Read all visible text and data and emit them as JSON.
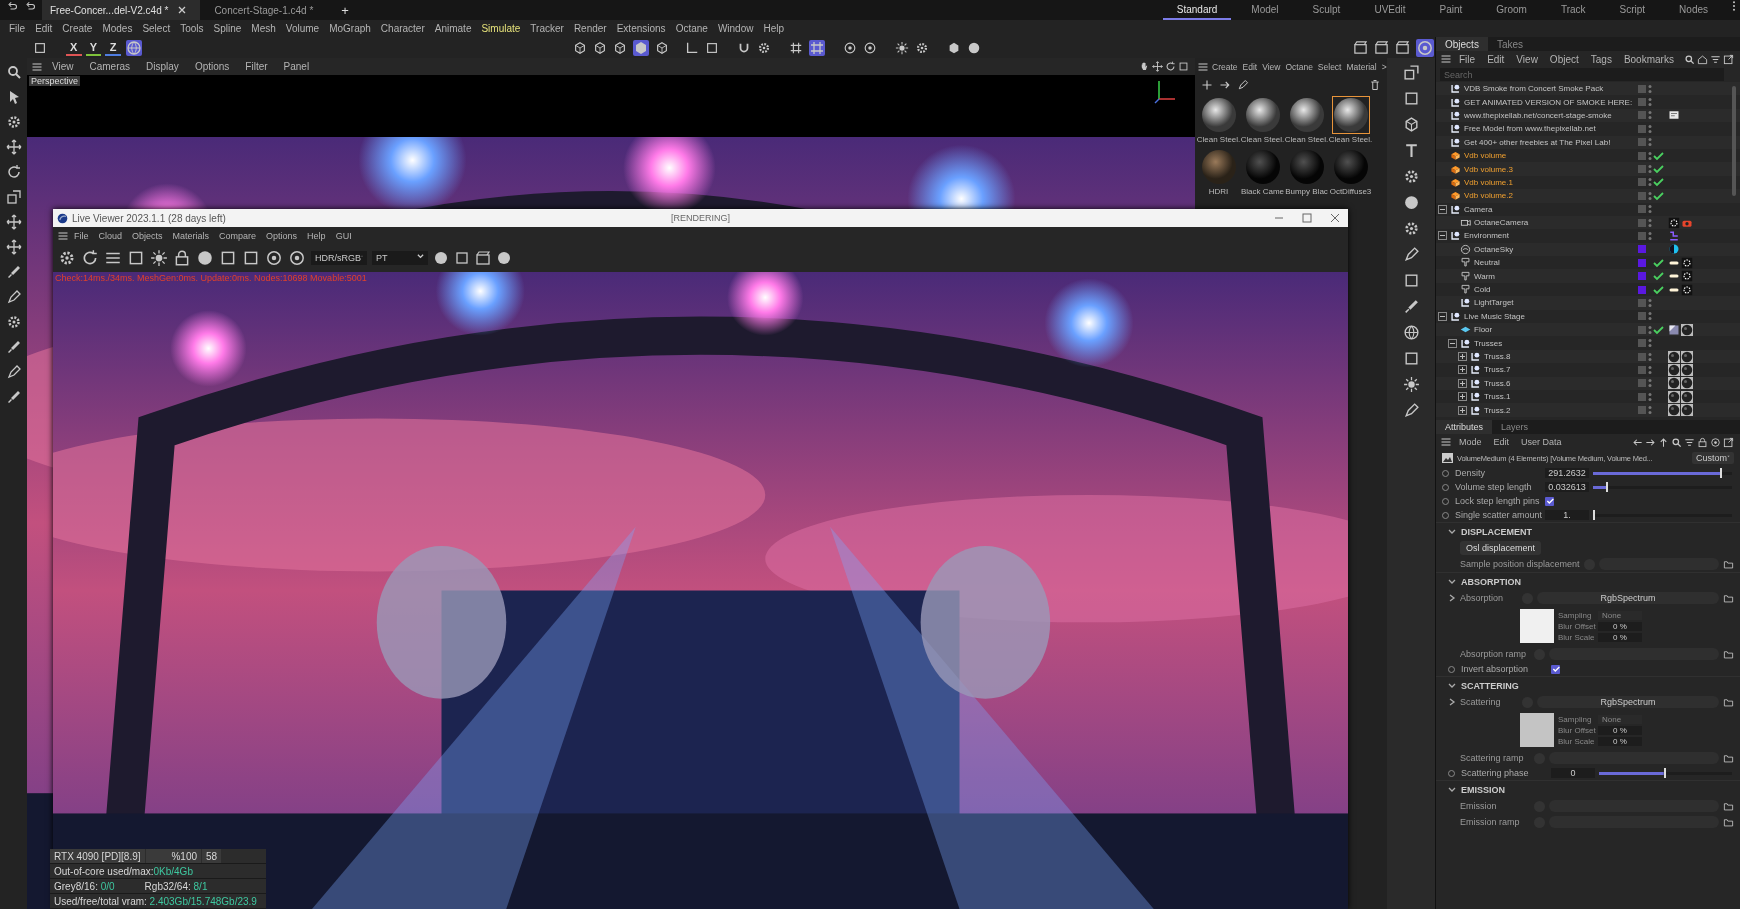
{
  "document_tabs": [
    {
      "label": "Free-Concer...del-V2.c4d *",
      "selected": true
    },
    {
      "label": "Concert-Stage-1.c4d *",
      "selected": false
    }
  ],
  "new_tab": "+",
  "layouts": [
    {
      "label": "Standard",
      "selected": true
    },
    {
      "label": "Model",
      "selected": false
    },
    {
      "label": "Sculpt",
      "selected": false
    },
    {
      "label": "UVEdit",
      "selected": false
    },
    {
      "label": "Paint",
      "selected": false
    },
    {
      "label": "Groom",
      "selected": false
    },
    {
      "label": "Track",
      "selected": false
    },
    {
      "label": "Script",
      "selected": false
    },
    {
      "label": "Nodes",
      "selected": false
    }
  ],
  "main_menu": [
    {
      "label": "File",
      "highlighted": false
    },
    {
      "label": "Edit",
      "highlighted": false
    },
    {
      "label": "Create",
      "highlighted": false
    },
    {
      "label": "Modes",
      "highlighted": false
    },
    {
      "label": "Select",
      "highlighted": false
    },
    {
      "label": "Tools",
      "highlighted": false
    },
    {
      "label": "Spline",
      "highlighted": false
    },
    {
      "label": "Mesh",
      "highlighted": false
    },
    {
      "label": "Volume",
      "highlighted": false
    },
    {
      "label": "MoGraph",
      "highlighted": false
    },
    {
      "label": "Character",
      "highlighted": false
    },
    {
      "label": "Animate",
      "highlighted": false
    },
    {
      "label": "Simulate",
      "highlighted": true
    },
    {
      "label": "Tracker",
      "highlighted": false
    },
    {
      "label": "Render",
      "highlighted": false
    },
    {
      "label": "Extensions",
      "highlighted": false
    },
    {
      "label": "Octane",
      "highlighted": false
    },
    {
      "label": "Window",
      "highlighted": false
    },
    {
      "label": "Help",
      "highlighted": false
    }
  ],
  "axis_toggles": [
    {
      "label": "X",
      "color": "#e05555"
    },
    {
      "label": "Y",
      "color": "#7fc23a"
    },
    {
      "label": "Z",
      "color": "#4f7de0"
    }
  ],
  "viewport": {
    "menu": [
      "View",
      "Cameras",
      "Display",
      "Options",
      "Filter",
      "Panel"
    ],
    "camera_label": "Perspective"
  },
  "material_manager": {
    "menu": [
      "Create",
      "Edit",
      "View",
      "Octane",
      "Select",
      "Material"
    ],
    "more": ">",
    "materials": [
      {
        "name": "Clean Steel.",
        "kind": "metal",
        "selected": false
      },
      {
        "name": "Clean Steel.",
        "kind": "metal",
        "selected": false
      },
      {
        "name": "Clean Steel.",
        "kind": "metal",
        "selected": false
      },
      {
        "name": "Clean Steel.",
        "kind": "metal",
        "selected": true
      },
      {
        "name": "HDRI",
        "kind": "hdri",
        "selected": false
      },
      {
        "name": "Black Came",
        "kind": "black",
        "selected": false
      },
      {
        "name": "Bumpy Blac",
        "kind": "black",
        "selected": false
      },
      {
        "name": "OctDiffuse3",
        "kind": "black",
        "selected": false
      }
    ]
  },
  "objects_panel": {
    "tabs": [
      {
        "label": "Objects",
        "selected": true
      },
      {
        "label": "Takes",
        "selected": false
      }
    ],
    "menu": [
      "File",
      "Edit",
      "View",
      "Object",
      "Tags",
      "Bookmarks"
    ],
    "search": {
      "placeholder": "Search"
    },
    "tree": [
      {
        "name": "VDB Smoke from Concert Smoke Pack",
        "kind": "null",
        "active": false,
        "layer": false
      },
      {
        "name": "GET ANIMATED VERSION OF SMOKE HERE:",
        "kind": "null",
        "active": false,
        "layer": false
      },
      {
        "name": "www.thepixellab.net/concert-stage-smoke",
        "kind": "null",
        "active": false,
        "layer": false,
        "tags": [
          {
            "kind": "note"
          }
        ]
      },
      {
        "name": "Free Model from www.thepixellab.net",
        "kind": "null",
        "active": false,
        "layer": false
      },
      {
        "name": "Get 400+ other freebies at The Pixel Lab!",
        "kind": "null",
        "active": false,
        "layer": false
      },
      {
        "name": "Vdb volume",
        "kind": "volume",
        "active": true,
        "layer": false
      },
      {
        "name": "Vdb volume.3",
        "kind": "volume",
        "active": true,
        "layer": false
      },
      {
        "name": "Vdb volume.1",
        "kind": "volume",
        "active": true,
        "layer": false
      },
      {
        "name": "Vdb volume.2",
        "kind": "volume",
        "active": true,
        "layer": false
      },
      {
        "name": "Camera",
        "kind": "null",
        "active": false,
        "layer": false,
        "expanded": true,
        "children": [
          {
            "name": "OctaneCamera",
            "kind": "camera",
            "active": false,
            "layer": false,
            "tags": [
              {
                "kind": "target"
              },
              {
                "kind": "camera"
              }
            ]
          }
        ]
      },
      {
        "name": "Environment",
        "kind": "null",
        "active": false,
        "layer": false,
        "tags": [
          {
            "kind": "xpresso"
          }
        ],
        "expanded": true,
        "children": [
          {
            "name": "OctaneSky",
            "kind": "sky",
            "active": false,
            "layer": true,
            "tags": [
              {
                "kind": "sky"
              }
            ]
          },
          {
            "name": "Neutral",
            "kind": "light",
            "active": true,
            "layer": true,
            "tags": [
              {
                "kind": "light"
              },
              {
                "kind": "target"
              }
            ]
          },
          {
            "name": "Warm",
            "kind": "light",
            "active": true,
            "layer": true,
            "tags": [
              {
                "kind": "light"
              },
              {
                "kind": "target"
              }
            ]
          },
          {
            "name": "Cold",
            "kind": "light",
            "active": true,
            "layer": true,
            "tags": [
              {
                "kind": "light"
              },
              {
                "kind": "target"
              }
            ]
          },
          {
            "name": "LightTarget",
            "kind": "null",
            "active": false,
            "layer": false
          }
        ]
      },
      {
        "name": "Live Music Stage",
        "kind": "null",
        "active": false,
        "layer": false,
        "expanded": true,
        "children": [
          {
            "name": "Floor",
            "kind": "floor",
            "active": true,
            "layer": false,
            "tags": [
              {
                "kind": "texture"
              },
              {
                "kind": "material"
              }
            ]
          },
          {
            "name": "Trusses",
            "kind": "null",
            "active": false,
            "layer": false,
            "expanded": true,
            "children": [
              {
                "name": "Truss.8",
                "kind": "null",
                "active": false,
                "layer": false,
                "tags": [
                  {
                    "kind": "material"
                  },
                  {
                    "kind": "material"
                  }
                ],
                "expanded": false
              },
              {
                "name": "Truss.7",
                "kind": "null",
                "active": false,
                "layer": false,
                "tags": [
                  {
                    "kind": "material"
                  },
                  {
                    "kind": "material"
                  }
                ],
                "expanded": false
              },
              {
                "name": "Truss.6",
                "kind": "null",
                "active": false,
                "layer": false,
                "tags": [
                  {
                    "kind": "material"
                  },
                  {
                    "kind": "material"
                  }
                ],
                "expanded": false
              },
              {
                "name": "Truss.1",
                "kind": "null",
                "active": false,
                "layer": false,
                "tags": [
                  {
                    "kind": "material"
                  },
                  {
                    "kind": "material"
                  }
                ],
                "expanded": false
              },
              {
                "name": "Truss.2",
                "kind": "null",
                "active": false,
                "layer": false,
                "tags": [
                  {
                    "kind": "material"
                  },
                  {
                    "kind": "material"
                  }
                ],
                "expanded": false
              }
            ]
          }
        ]
      }
    ]
  },
  "attributes": {
    "tabs": [
      {
        "label": "Attributes",
        "selected": true
      },
      {
        "label": "Layers",
        "selected": false
      }
    ],
    "menu": [
      "Mode",
      "Edit",
      "User Data"
    ],
    "header": {
      "title": "VolumeMedium (4 Elements) [Volume Medium, Volume Med...",
      "mode": "Custom"
    },
    "params": [
      {
        "kind": "slider",
        "label": "Density",
        "value": "291.2632",
        "level": 0.93
      },
      {
        "kind": "slider",
        "label": "Volume step length",
        "value": "0.032613",
        "level": 0.11
      },
      {
        "kind": "checkbox",
        "label": "Lock step length pins",
        "checked": true
      },
      {
        "kind": "slider",
        "label": "Single scatter amount",
        "value": "1.",
        "level": 0.01
      }
    ],
    "sections": [
      {
        "title": "DISPLACEMENT",
        "expanded": true,
        "rows": [
          {
            "kind": "button",
            "label": "Osl displacement"
          },
          {
            "kind": "link",
            "label": "Sample position displacement"
          }
        ]
      },
      {
        "title": "ABSORPTION",
        "expanded": true,
        "rows": [
          {
            "kind": "shader",
            "label": "Absorption",
            "shader": "RgbSpectrum",
            "color": "#f0f0f0",
            "fields": [
              {
                "label": "Sampling",
                "value": "None"
              },
              {
                "label": "Blur Offset",
                "value": "0 %"
              },
              {
                "label": "Blur Scale",
                "value": "0 %"
              }
            ]
          },
          {
            "kind": "link",
            "label": "Absorption ramp"
          },
          {
            "kind": "checkbox",
            "label": "Invert absorption",
            "checked": true
          }
        ]
      },
      {
        "title": "SCATTERING",
        "expanded": true,
        "rows": [
          {
            "kind": "shader",
            "label": "Scattering",
            "shader": "RgbSpectrum",
            "color": "#c4c4c4",
            "fields": [
              {
                "label": "Sampling",
                "value": "None"
              },
              {
                "label": "Blur Offset",
                "value": "0 %"
              },
              {
                "label": "Blur Scale",
                "value": "0 %"
              }
            ]
          },
          {
            "kind": "link",
            "label": "Scattering ramp"
          },
          {
            "kind": "slider",
            "label": "Scattering phase",
            "value": "0",
            "level": 0.5
          }
        ]
      },
      {
        "title": "EMISSION",
        "expanded": true,
        "rows": [
          {
            "kind": "link",
            "label": "Emission"
          },
          {
            "kind": "link",
            "label": "Emission ramp"
          }
        ]
      }
    ]
  },
  "live_viewer": {
    "title": "Live Viewer 2023.1.1 (28 days left)",
    "status": "[RENDERING]",
    "menu": [
      "File",
      "Cloud",
      "Objects",
      "Materials",
      "Compare",
      "Options",
      "Help",
      "GUI"
    ],
    "dropdowns": [
      "HDR/sRGB",
      "PT"
    ],
    "stats_line": "Check:14ms./34ms. MeshGen:0ms. Update:0ms. Nodes:10698 Movable:5001",
    "gpu": {
      "name": "RTX 4090 [PD][8.9]",
      "percent": "%100",
      "value": "58"
    },
    "memory": [
      [
        {
          "label": "Out-of-core used/max:",
          "value": "0Kb/4Gb"
        }
      ],
      [
        {
          "label": "Grey8/16: ",
          "value": "0/0"
        },
        {
          "label": "Rgb32/64: ",
          "value": "8/1"
        }
      ],
      [
        {
          "label": "Used/free/total vram: ",
          "value": "2.403Gb/15.748Gb/23.9"
        }
      ]
    ]
  }
}
